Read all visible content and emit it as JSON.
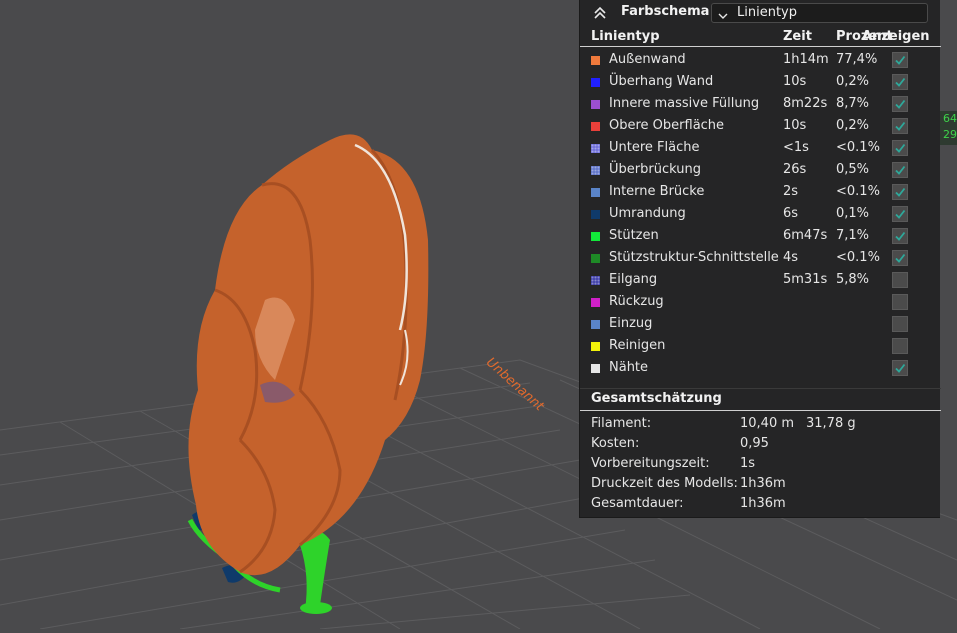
{
  "viewport": {
    "plate_label": "Unbenannt",
    "coords_readout": [
      "64",
      "29"
    ],
    "colors": {
      "background": "#4a4a4c",
      "grid": "#5a5a5c",
      "model": "#c8642e",
      "support": "#2ed32a"
    }
  },
  "panel": {
    "title": "Farbschema",
    "scheme_select": {
      "value": "Linientyp"
    },
    "columns": {
      "type": "Linientyp",
      "time": "Zeit",
      "percent": "Prozent",
      "show": "Anzeigen"
    },
    "rows": [
      {
        "name": "Außenwand",
        "time": "1h14m",
        "percent": "77,4%",
        "color": "#f07a3c",
        "pattern": false,
        "checked": true
      },
      {
        "name": "Überhang Wand",
        "time": "10s",
        "percent": "0,2%",
        "color": "#2020ff",
        "pattern": false,
        "checked": true
      },
      {
        "name": "Innere massive Füllung",
        "time": "8m22s",
        "percent": "8,7%",
        "color": "#9c4fcf",
        "pattern": false,
        "checked": true
      },
      {
        "name": "Obere Oberfläche",
        "time": "10s",
        "percent": "0,2%",
        "color": "#e8403a",
        "pattern": false,
        "checked": true
      },
      {
        "name": "Untere Fläche",
        "time": "<1s",
        "percent": "<0.1%",
        "color": "#6a6ad8",
        "pattern": true,
        "checked": true
      },
      {
        "name": "Überbrückung",
        "time": "26s",
        "percent": "0,5%",
        "color": "#5a70c8",
        "pattern": true,
        "checked": true
      },
      {
        "name": "Interne Brücke",
        "time": "2s",
        "percent": "<0.1%",
        "color": "#5a84c8",
        "pattern": false,
        "checked": true
      },
      {
        "name": "Umrandung",
        "time": "6s",
        "percent": "0,1%",
        "color": "#0f3a6a",
        "pattern": false,
        "checked": true
      },
      {
        "name": "Stützen",
        "time": "6m47s",
        "percent": "7,1%",
        "color": "#12e83a",
        "pattern": false,
        "checked": true
      },
      {
        "name": "Stützstruktur-Schnittstelle",
        "time": "4s",
        "percent": "<0.1%",
        "color": "#1e8a26",
        "pattern": false,
        "checked": true
      },
      {
        "name": "Eilgang",
        "time": "5m31s",
        "percent": "5,8%",
        "color": "#3a3aa8",
        "pattern": true,
        "checked": false
      },
      {
        "name": "Rückzug",
        "time": "",
        "percent": "",
        "color": "#d020c8",
        "pattern": false,
        "checked": false
      },
      {
        "name": "Einzug",
        "time": "",
        "percent": "",
        "color": "#5a84c8",
        "pattern": false,
        "checked": false
      },
      {
        "name": "Reinigen",
        "time": "",
        "percent": "",
        "color": "#f2f20a",
        "pattern": false,
        "checked": false
      },
      {
        "name": "Nähte",
        "time": "",
        "percent": "",
        "color": "#e6e6e6",
        "pattern": false,
        "checked": true
      }
    ],
    "summary": {
      "title": "Gesamtschätzung",
      "rows": [
        {
          "label": "Filament:",
          "value": "10,40 m",
          "value2": "31,78 g"
        },
        {
          "label": "Kosten:",
          "value": "0,95",
          "value2": ""
        },
        {
          "label": "Vorbereitungszeit:",
          "value": "1s",
          "value2": ""
        },
        {
          "label": "Druckzeit des Modells:",
          "value": "1h36m",
          "value2": ""
        },
        {
          "label": "Gesamtdauer:",
          "value": "1h36m",
          "value2": ""
        }
      ]
    },
    "check_color": "#2ea89a"
  }
}
